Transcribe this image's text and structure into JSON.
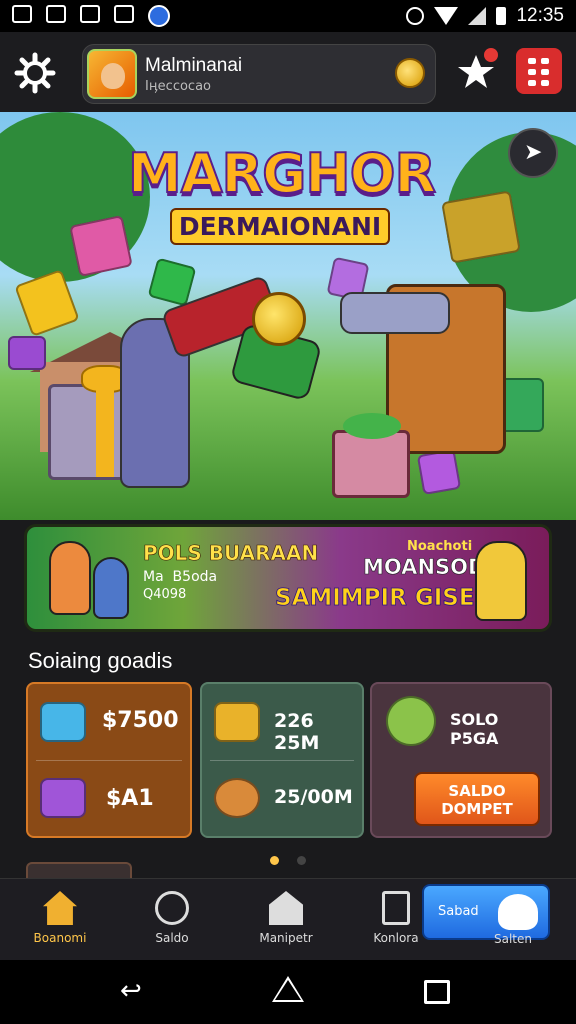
{
  "status_bar": {
    "time": "12:35"
  },
  "header": {
    "player_name": "Malminanai",
    "player_sub": "Іӊессосао"
  },
  "hero": {
    "title": "MARGHOR",
    "subtitle": "DERMAIONANI"
  },
  "promo_banner": {
    "left_title": "POLS BUARAAN",
    "left_line1": "Ma  B5oda",
    "left_line2": "Q4098",
    "right_small": "Noachoti",
    "right_title": "MOANSODI",
    "right_big": "SAMIMPIR GISE!"
  },
  "section_title": "Soiaing goadis",
  "cards": [
    {
      "rows": [
        {
          "icon": "blue-gem-box-icon",
          "price": "$7500"
        },
        {
          "icon": "purple-chest-icon",
          "price": "$A1"
        }
      ]
    },
    {
      "rows": [
        {
          "icon": "golden-treasure-icon",
          "price": "226 25M"
        },
        {
          "icon": "pet-creature-icon",
          "price": "25/00M"
        }
      ]
    },
    {
      "rows": [
        {
          "icon": "dragon-egg-icon",
          "price": "SOLO P5GA"
        }
      ],
      "button": "SALDO\nDOMPET"
    }
  ],
  "carousel": {
    "pages": 2,
    "active": 1
  },
  "bottom_nav": [
    {
      "label": "Boanomi",
      "icon": "home-icon",
      "active": true
    },
    {
      "label": "Saldo",
      "icon": "clock-coin-icon",
      "active": false
    },
    {
      "label": "Manipetr",
      "icon": "store-icon",
      "active": false
    },
    {
      "label": "Konlora",
      "icon": "tablet-icon",
      "active": false
    }
  ],
  "float_button": {
    "label": "Sabad",
    "bottom_label": "Salten"
  },
  "colors": {
    "accent": "#ffc64a",
    "danger": "#d92d2d",
    "primary_blue": "#1f6ae0"
  }
}
